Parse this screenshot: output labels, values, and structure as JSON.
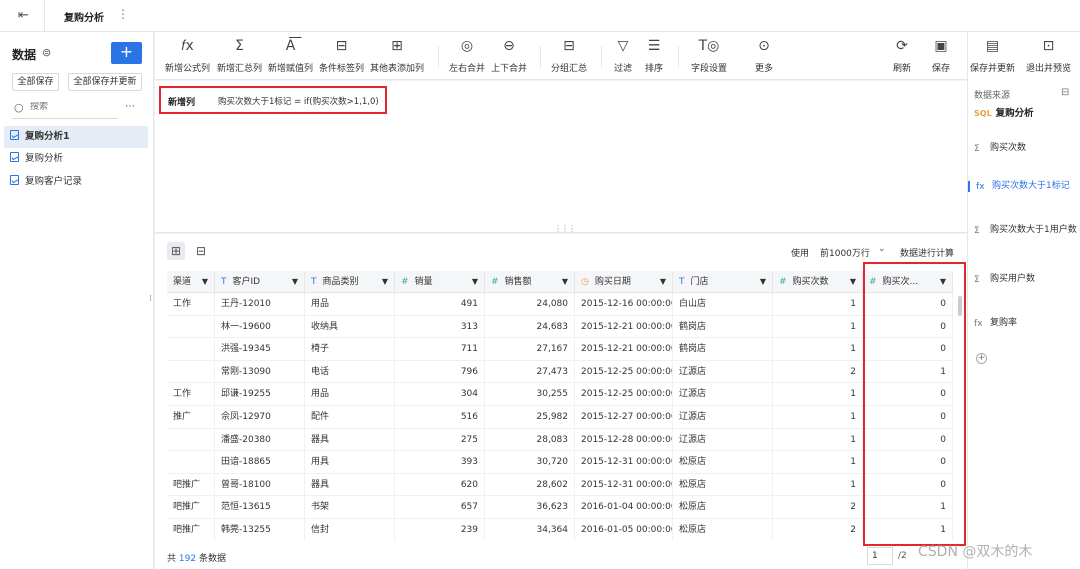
{
  "topbar": {
    "tab_title": "复购分析",
    "back_icon": "collapse-icon",
    "menu_icon": "more-vertical-icon"
  },
  "left": {
    "header": "数据",
    "add_label": "+",
    "btn_save_all": "全部保存",
    "btn_save_update": "全部保存并更新",
    "search_placeholder": "搜索",
    "items": [
      {
        "label": "复购分析1",
        "active": true
      },
      {
        "label": "复购分析",
        "active": false
      },
      {
        "label": "复购客户记录",
        "active": false
      }
    ]
  },
  "toolbar": {
    "formula": "新增公式列",
    "summary": "新增汇总列",
    "assign": "新增赋值列",
    "cond_tag": "条件标签列",
    "other_add": "其他表添加列",
    "lr_merge": "左右合并",
    "ud_merge": "上下合并",
    "group": "分组汇总",
    "filter": "过滤",
    "sort": "排序",
    "field_set": "字段设置",
    "more": "更多",
    "refresh": "刷新",
    "save": "保存",
    "save_update": "保存并更新",
    "exit_preview": "退出并预览"
  },
  "editor": {
    "label": "新增列",
    "expression": "购买次数大于1标记 = if(购买次数>1,1,0)"
  },
  "right_panel": {
    "title": "数据来源",
    "source": "复购分析",
    "sql_label": "SQL",
    "items": [
      {
        "icon": "Σ",
        "label": "购买次数"
      },
      {
        "icon": "fx",
        "label": "购买次数大于1标记"
      },
      {
        "icon": "Σ",
        "label": "购买次数大于1用户数"
      },
      {
        "icon": "Σ",
        "label": "购买用户数"
      },
      {
        "icon": "fx",
        "label": "复购率"
      }
    ]
  },
  "main": {
    "use_label": "使用",
    "select_value": "前1000万行",
    "calc_label": "数据进行计算",
    "footer_prefix": "共",
    "footer_count": "192",
    "footer_suffix": "条数据",
    "page_current": "1",
    "page_total": "/2"
  },
  "table": {
    "columns": [
      {
        "type": "t",
        "label": "渠道"
      },
      {
        "type": "t",
        "label": "客户ID"
      },
      {
        "type": "t",
        "label": "商品类别"
      },
      {
        "type": "n",
        "label": "销量"
      },
      {
        "type": "n",
        "label": "销售额"
      },
      {
        "type": "d",
        "label": "购买日期"
      },
      {
        "type": "t",
        "label": "门店"
      },
      {
        "type": "n",
        "label": "购买次数"
      },
      {
        "type": "n",
        "label": "购买次..."
      }
    ],
    "rows": [
      [
        "工作",
        "王丹-12010",
        "用品",
        "491",
        "24,080",
        "2015-12-16 00:00:00",
        "白山店",
        "1",
        "0"
      ],
      [
        "",
        "林一-19600",
        "收纳具",
        "313",
        "24,683",
        "2015-12-21 00:00:00",
        "鹤岗店",
        "1",
        "0"
      ],
      [
        "",
        "洪强-19345",
        "椅子",
        "711",
        "27,167",
        "2015-12-21 00:00:00",
        "鹤岗店",
        "1",
        "0"
      ],
      [
        "",
        "常刚-13090",
        "电话",
        "796",
        "27,473",
        "2015-12-25 00:00:00",
        "辽源店",
        "2",
        "1"
      ],
      [
        "工作",
        "邱谦-19255",
        "用品",
        "304",
        "30,255",
        "2015-12-25 00:00:00",
        "辽源店",
        "1",
        "0"
      ],
      [
        "推广",
        "佘凤-12970",
        "配件",
        "516",
        "25,982",
        "2015-12-27 00:00:00",
        "辽源店",
        "1",
        "0"
      ],
      [
        "",
        "潘盛-20380",
        "器具",
        "275",
        "28,083",
        "2015-12-28 00:00:00",
        "辽源店",
        "1",
        "0"
      ],
      [
        "",
        "田谙-18865",
        "用具",
        "393",
        "30,720",
        "2015-12-31 00:00:00",
        "松原店",
        "1",
        "0"
      ],
      [
        "吧推广",
        "曾哥-18100",
        "器具",
        "620",
        "28,602",
        "2015-12-31 00:00:00",
        "松原店",
        "1",
        "0"
      ],
      [
        "吧推广",
        "范恒-13615",
        "书架",
        "657",
        "36,623",
        "2016-01-04 00:00:00",
        "松原店",
        "2",
        "1"
      ],
      [
        "吧推广",
        "韩莞-13255",
        "信封",
        "239",
        "34,364",
        "2016-01-05 00:00:00",
        "松原店",
        "2",
        "1"
      ]
    ]
  },
  "watermark": "CSDN @双木的木"
}
